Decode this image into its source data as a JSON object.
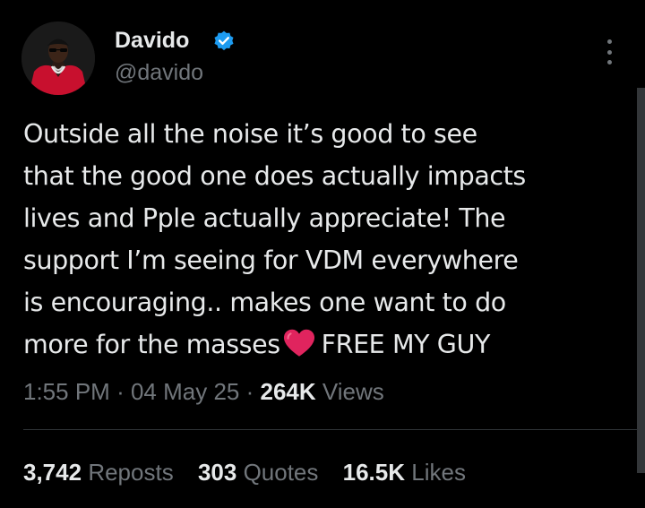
{
  "author": {
    "name": "Davido",
    "handle": "@davido",
    "verified": true,
    "avatar": "profile-photo-red-jacket"
  },
  "tweet": {
    "lines": [
      "Outside all the noise it’s good to see",
      "that the good one does actually impacts",
      "lives and Pple actually appreciate! The",
      "support I’m seeing for VDM everywhere",
      "is encouraging.. makes one want to do"
    ],
    "last_line_before_emoji": "more for the masses",
    "emoji": "red-heart-icon",
    "last_line_after_emoji": "FREE MY GUY"
  },
  "meta": {
    "time": "1:55 PM",
    "separator": "·",
    "date": "04 May 25",
    "views_count": "264K",
    "views_label": "Views"
  },
  "stats": {
    "reposts_count": "3,742",
    "reposts_label": "Reposts",
    "quotes_count": "303",
    "quotes_label": "Quotes",
    "likes_count": "16.5K",
    "likes_label": "Likes"
  },
  "colors": {
    "background": "#000000",
    "text_primary": "#e7e9ea",
    "text_secondary": "#71767b",
    "verified_blue": "#1d9bf0",
    "heart_red": "#e0245e",
    "divider": "#2f3336"
  }
}
